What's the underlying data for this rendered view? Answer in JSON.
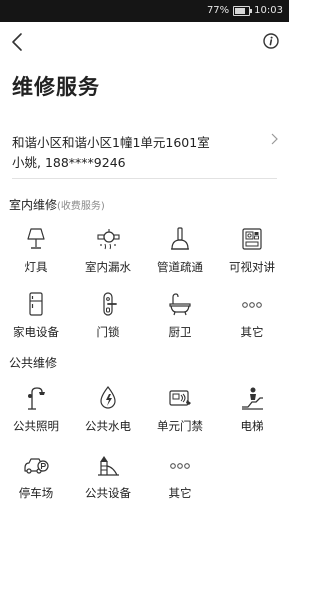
{
  "statusbar": {
    "battery": "77%",
    "time": "10:03",
    "battery_level": 0.77
  },
  "header": {
    "title": "维修服务"
  },
  "address": {
    "line": "和谐小区和谐小区1幢1单元1601室",
    "contact": "小姚, 188****9246"
  },
  "indoor": {
    "title": "室内维修",
    "subtitle": "(收费服务)",
    "items": [
      {
        "label": "灯具",
        "icon": "lamp-icon"
      },
      {
        "label": "室内漏水",
        "icon": "leaking-pipe-icon"
      },
      {
        "label": "管道疏通",
        "icon": "plunger-icon"
      },
      {
        "label": "可视对讲",
        "icon": "video-intercom-icon"
      },
      {
        "label": "家电设备",
        "icon": "refrigerator-icon"
      },
      {
        "label": "门锁",
        "icon": "door-lock-icon"
      },
      {
        "label": "厨卫",
        "icon": "bathtub-icon"
      },
      {
        "label": "其它",
        "icon": "more-icon"
      }
    ]
  },
  "public": {
    "title": "公共维修",
    "items": [
      {
        "label": "公共照明",
        "icon": "street-lamp-icon"
      },
      {
        "label": "公共水电",
        "icon": "water-electric-icon"
      },
      {
        "label": "单元门禁",
        "icon": "access-control-icon"
      },
      {
        "label": "电梯",
        "icon": "elevator-icon"
      },
      {
        "label": "停车场",
        "icon": "parking-icon"
      },
      {
        "label": "公共设备",
        "icon": "playground-icon"
      },
      {
        "label": "其它",
        "icon": "more-icon"
      }
    ]
  }
}
